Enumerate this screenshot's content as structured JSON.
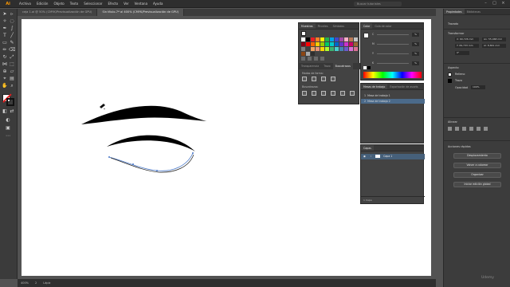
{
  "menubar": {
    "logo": "Ai",
    "items": [
      "Archivo",
      "Edición",
      "Objeto",
      "Texto",
      "Seleccionar",
      "Efecto",
      "Ver",
      "Ventana",
      "Ayuda"
    ],
    "search_placeholder": "Buscar tutoriales"
  },
  "tabs": [
    {
      "label": "ceja 1.ai @ 50% (CMYK/Previsualización de GPU)"
    },
    {
      "label": "Sin título-7* al 400% (CMYK/Previsualización de GPU)"
    }
  ],
  "swatches_panel": {
    "tabs": [
      "Muestras",
      "Pinceles",
      "Símbolos"
    ],
    "colors": [
      "#ffffff",
      "#000000",
      "#ed1c24",
      "#ff7f27",
      "#fff200",
      "#22b14c",
      "#00a2e8",
      "#3f48cc",
      "#a349a4",
      "#ffaec9",
      "#b97a57",
      "#c3c3c3",
      "#880015",
      "#ff0000",
      "#ff6600",
      "#ffcc00",
      "#99cc00",
      "#00cc66",
      "#00cccc",
      "#0066cc",
      "#6633cc",
      "#cc33cc",
      "#cc0066",
      "#996633",
      "#808080",
      "#404040",
      "#f4a460",
      "#e9967a",
      "#ffd700",
      "#adff2f",
      "#3cb371",
      "#48d1cc",
      "#4682b4",
      "#6a5acd",
      "#da70d6",
      "#db7093",
      "#8b4513",
      "#a9a9a9",
      "#2f2f2f"
    ],
    "subtabs": [
      "Transparencia",
      "Trazo",
      "Buscatrazos"
    ],
    "formas_label": "Modos de forma:",
    "buscatrazos_label": "Buscatrazos:"
  },
  "color_panel": {
    "tabs": [
      "Color",
      "Guía de color"
    ],
    "channels": [
      {
        "name": "C",
        "value": "%"
      },
      {
        "name": "M",
        "value": "%"
      },
      {
        "name": "Y",
        "value": "%"
      },
      {
        "name": "K",
        "value": "%"
      }
    ]
  },
  "artboards_panel": {
    "tabs": [
      "Mesas de trabajo",
      "Exportación de assets"
    ],
    "rows": [
      {
        "num": "1",
        "name": "Mesa de trabajo 1"
      },
      {
        "num": "2",
        "name": "Mesa de trabajo 2"
      }
    ]
  },
  "layers_panel": {
    "tabs": [
      "Capas"
    ],
    "rows": [
      {
        "name": "Capa 1"
      }
    ],
    "footer": "1 Capa"
  },
  "properties_panel": {
    "tabs": [
      "Propiedades",
      "Bibliotecas"
    ],
    "section_title": "Trazado",
    "transform_title": "Transformar",
    "x": "X: 60,726 mm",
    "y": "Y: 69,733 mm",
    "w": "An: 55,468 mm",
    "h": "Al: 8,841 mm",
    "rotation": "0°",
    "appearance_title": "Aspecto",
    "fill_label": "Relleno",
    "stroke_label": "Trazo",
    "opacity_label": "Opacidad",
    "opacity_value": "100%",
    "align_title": "Alinear",
    "quick_actions_title": "Acciones rápidas",
    "quick_actions": [
      "Desplazamiento",
      "Volver a colorear",
      "Organizar",
      "Iniciar edición global"
    ]
  },
  "status": {
    "zoom": "400%",
    "page": "2",
    "tool": "Lápiz"
  },
  "watermark": "Udemy"
}
